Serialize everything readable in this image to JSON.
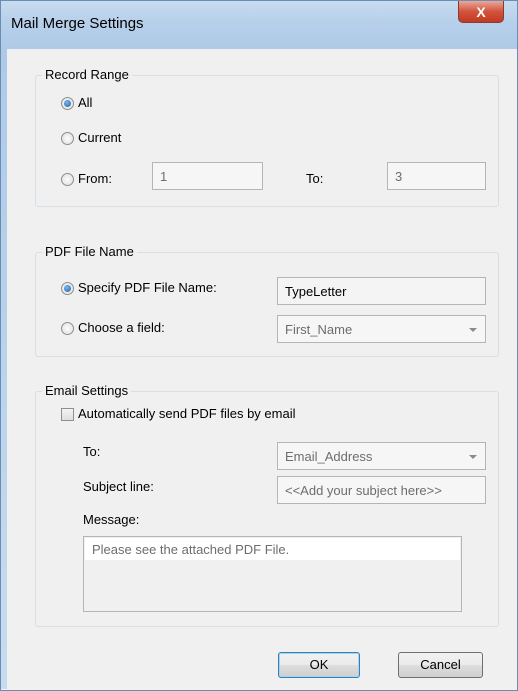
{
  "window": {
    "title": "Mail Merge Settings",
    "close_label": "X"
  },
  "record_range": {
    "legend": "Record Range",
    "all_label": "All",
    "current_label": "Current",
    "from_label": "From:",
    "from_value": "1",
    "to_label": "To:",
    "to_value": "3",
    "selected": "All"
  },
  "pdf_file_name": {
    "legend": "PDF File Name",
    "specify_label": "Specify PDF File Name:",
    "specify_value": "TypeLetter",
    "choose_label": "Choose a field:",
    "choose_value": "First_Name",
    "selected": "Specify PDF File Name:"
  },
  "email_settings": {
    "legend": "Email Settings",
    "auto_send_label": "Automatically send PDF files by email",
    "auto_send_checked": false,
    "to_label": "To:",
    "to_value": "Email_Address",
    "subject_label": "Subject line:",
    "subject_placeholder": "<<Add your subject here>>",
    "message_label": "Message:",
    "message_value": "Please see the attached PDF File."
  },
  "buttons": {
    "ok": "OK",
    "cancel": "Cancel"
  },
  "colors": {
    "title_bar": "#b8d0ea",
    "close_button": "#d2533d",
    "dialog_bg": "#f0f0f0"
  }
}
